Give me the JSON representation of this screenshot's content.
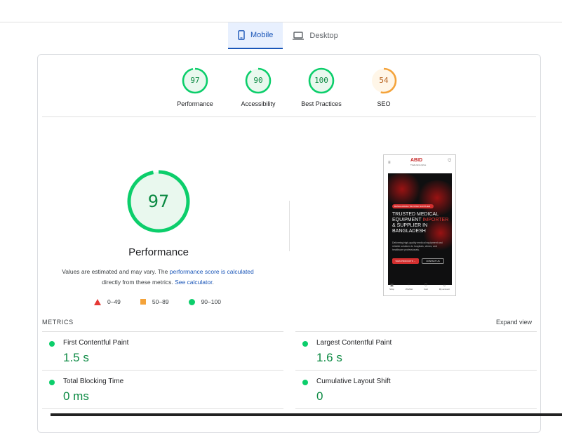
{
  "tabs": [
    {
      "label": "Mobile",
      "icon": "smartphone-icon",
      "active": true
    },
    {
      "label": "Desktop",
      "icon": "laptop-icon",
      "active": false
    }
  ],
  "categories": [
    {
      "label": "Performance",
      "score": "97",
      "fraction": 0.97,
      "color": "#0cce6b"
    },
    {
      "label": "Accessibility",
      "score": "90",
      "fraction": 0.9,
      "color": "#0cce6b"
    },
    {
      "label": "Best Practices",
      "score": "100",
      "fraction": 1.0,
      "color": "#0cce6b"
    },
    {
      "label": "SEO",
      "score": "54",
      "fraction": 0.54,
      "color": "#f4a33a"
    }
  ],
  "main_gauge": {
    "score": "97",
    "fraction": 0.97,
    "title": "Performance"
  },
  "note": {
    "text1": "Values are estimated and may vary. The ",
    "link1": "performance score is calculated",
    "text2": " directly from these metrics. ",
    "link2": "See calculator",
    "text3": "."
  },
  "legend": [
    {
      "label": "0–49",
      "shape": "triangle",
      "color": "#e53935"
    },
    {
      "label": "50–89",
      "shape": "square",
      "color": "#f4a33a"
    },
    {
      "label": "90–100",
      "shape": "circle",
      "color": "#0cce6b"
    }
  ],
  "screenshot": {
    "logo": "ABID",
    "logo_sub": "Trade Enterprise",
    "badge": "BANGLADESH TRUSTED SUPPLIER",
    "headline_a": "TRUSTED MEDICAL EQUIPMENT ",
    "headline_red": "IMPORTER",
    "headline_b": " & SUPPLIER IN BANGLADESH",
    "para": "Delivering high-quality medical equipment and reliable solutions to hospitals, clinics, and healthcare professionals.",
    "btn_primary": "VIEW PRODUCTS →",
    "btn_secondary": "CONTACT US",
    "nav": [
      "Shop",
      "Wishlist",
      "Cart",
      "My account"
    ]
  },
  "metrics": {
    "heading": "METRICS",
    "expand_label": "Expand view",
    "items": [
      {
        "label": "First Contentful Paint",
        "value": "1.5 s"
      },
      {
        "label": "Largest Contentful Paint",
        "value": "1.6 s"
      },
      {
        "label": "Total Blocking Time",
        "value": "0 ms"
      },
      {
        "label": "Cumulative Layout Shift",
        "value": "0"
      }
    ]
  }
}
